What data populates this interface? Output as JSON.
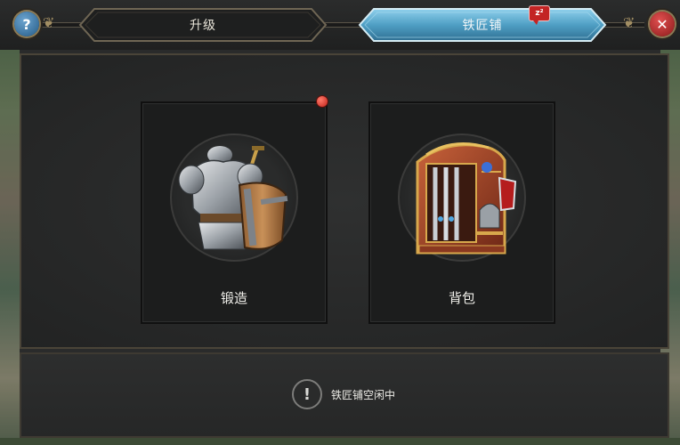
{
  "tabs": [
    {
      "label": "升级",
      "active": false
    },
    {
      "label": "铁匠铺",
      "active": true
    }
  ],
  "notification_badge": "z²",
  "help_label": "?",
  "close_label": "✕",
  "cards": [
    {
      "label": "锻造",
      "icon": "armor-shield-icon",
      "has_alert": true
    },
    {
      "label": "背包",
      "icon": "weapon-rack-icon",
      "has_alert": false
    }
  ],
  "status": {
    "icon_glyph": "!",
    "text": "铁匠铺空闲中"
  },
  "colors": {
    "accent_blue": "#5fb3d6",
    "alert_red": "#d23a2e",
    "frame_gold": "#a28e63"
  }
}
